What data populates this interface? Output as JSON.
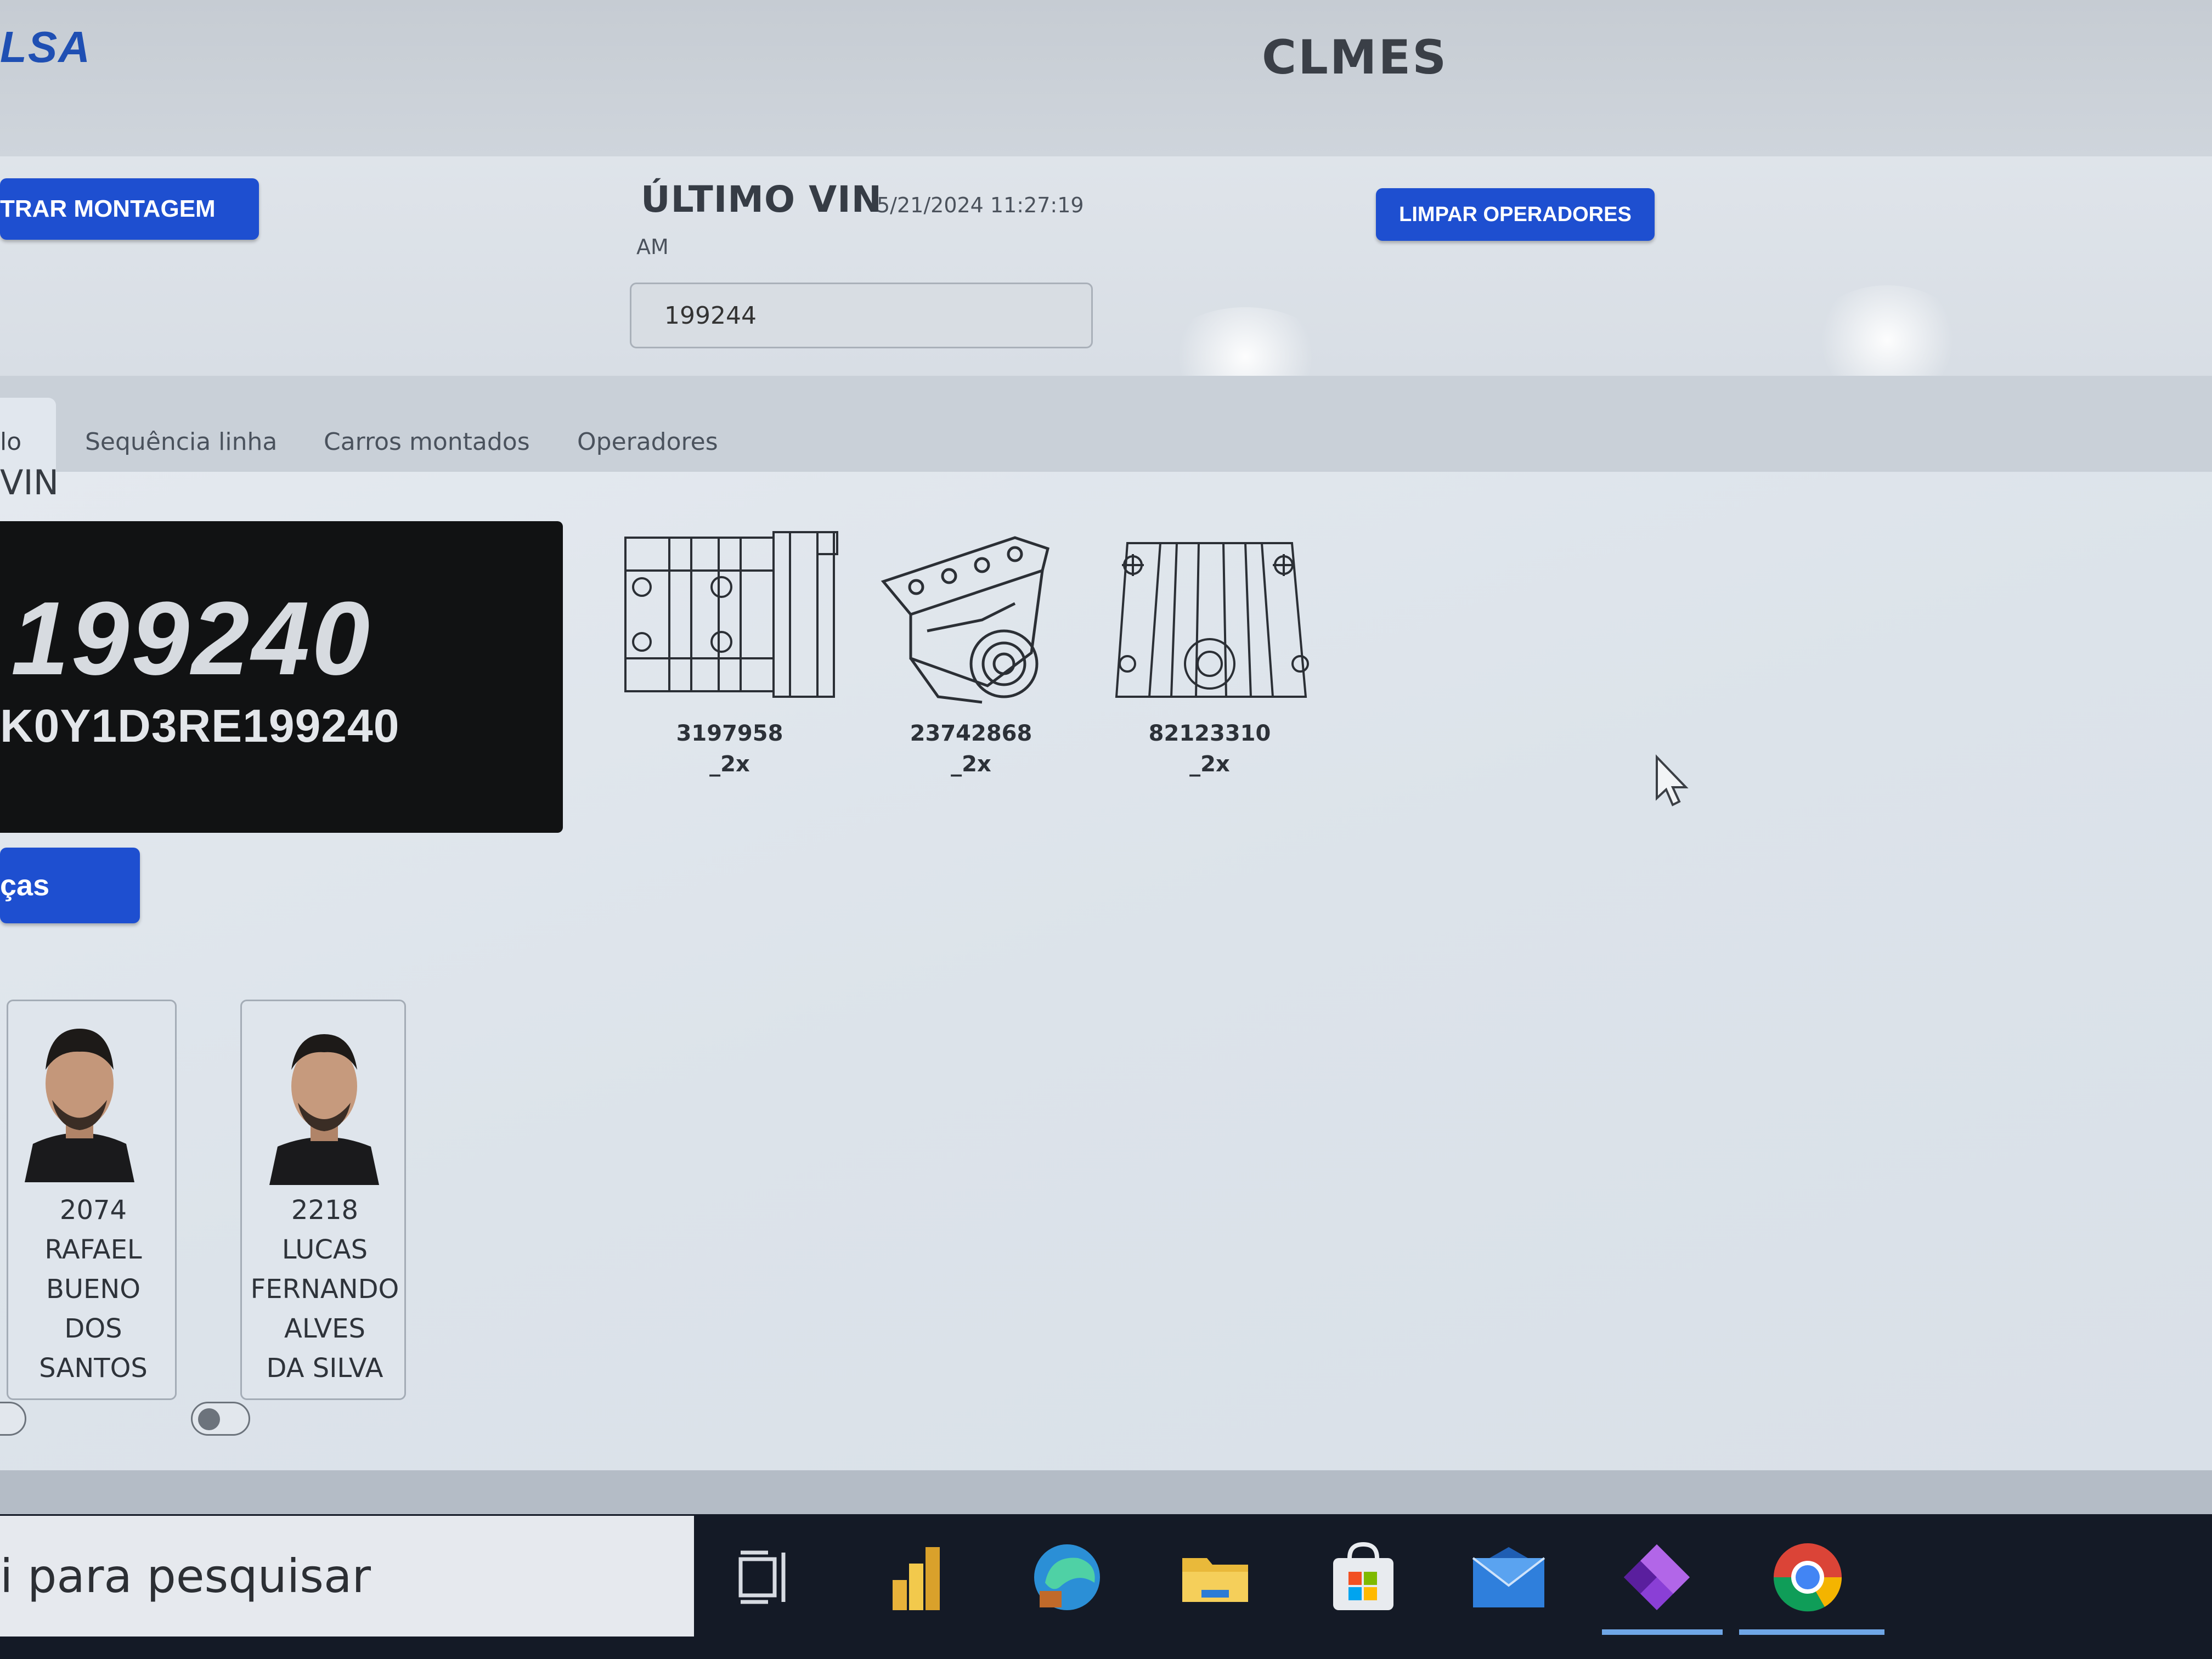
{
  "header": {
    "logo": "LSA",
    "title": "CLMES"
  },
  "controls": {
    "registrar_montagem_label": "TRAR MONTAGEM",
    "ultimo_vin_label": "ÚLTIMO VIN",
    "ultimo_vin_timestamp": "5/21/2024 11:27:19",
    "ultimo_vin_ampm": "AM",
    "vin_input_value": "199244",
    "limpar_operadores_label": "LIMPAR OPERADORES"
  },
  "tabs": [
    {
      "label": "lo",
      "active": true
    },
    {
      "label": "Sequência linha",
      "active": false
    },
    {
      "label": "Carros montados",
      "active": false
    },
    {
      "label": "Operadores",
      "active": false
    }
  ],
  "vin_section": {
    "heading": "VIN",
    "short_vin": "199240",
    "full_vin": "K0Y1D3RE199240",
    "pecas_button_label": "ças"
  },
  "parts": [
    {
      "code": "3197958",
      "qty": "_2x",
      "icon": "bracket-drawing"
    },
    {
      "code": "23742868",
      "qty": "_2x",
      "icon": "engine-mount-drawing"
    },
    {
      "code": "82123310",
      "qty": "_2x",
      "icon": "plate-drawing"
    }
  ],
  "operators": [
    {
      "lines": [
        "2074",
        "RAFAEL",
        "BUENO",
        "DOS",
        "SANTOS"
      ]
    },
    {
      "lines": [
        "2218",
        "LUCAS",
        "FERNANDO",
        "ALVES",
        "DA SILVA"
      ]
    }
  ],
  "taskbar": {
    "search_placeholder": "i para pesquisar",
    "icons": [
      "task-view-icon",
      "power-bi-icon",
      "edge-icon",
      "file-explorer-icon",
      "store-icon",
      "mail-icon",
      "power-apps-icon",
      "chrome-icon"
    ]
  },
  "colors": {
    "accent": "#1e4fd0",
    "vin_card": "#111213",
    "taskbar": "#141a26"
  }
}
